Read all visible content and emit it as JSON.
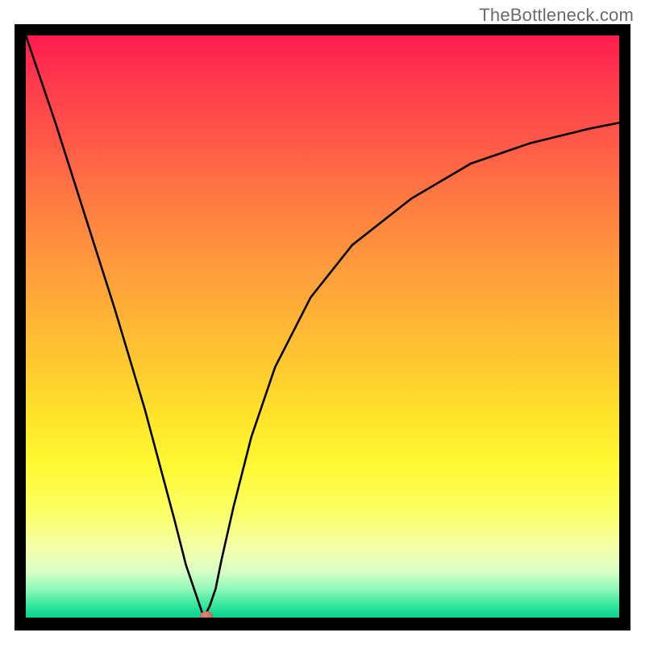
{
  "watermark": "TheBottleneck.com",
  "chart_data": {
    "type": "line",
    "title": "",
    "xlabel": "",
    "ylabel": "",
    "xlim": [
      0,
      100
    ],
    "ylim": [
      0,
      100
    ],
    "x": [
      0,
      5,
      10,
      15,
      20,
      25,
      27,
      29,
      30,
      31,
      32,
      33,
      35,
      38,
      42,
      48,
      55,
      65,
      75,
      85,
      95,
      100
    ],
    "y": [
      100,
      85,
      69,
      53,
      36,
      17,
      9,
      3,
      0,
      2,
      5,
      10,
      19,
      31,
      43,
      55,
      64,
      72,
      78,
      81.5,
      84,
      85
    ],
    "marker": {
      "x": 30.5,
      "y": 0.3
    },
    "gradient_colors": {
      "top": "#ff1a4f",
      "mid_upper": "#ff963d",
      "mid": "#ffe52a",
      "mid_lower": "#f4ffa8",
      "bottom": "#0fd18e"
    },
    "frame_color": "#000000",
    "curve_stroke": "#000000"
  }
}
